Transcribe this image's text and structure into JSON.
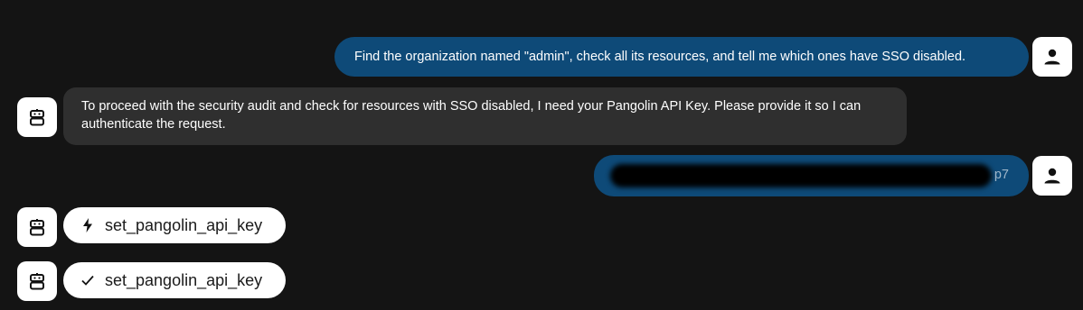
{
  "messages": [
    {
      "role": "user",
      "text": "Find the organization named \"admin\", check all its resources, and tell me which ones have SSO disabled."
    },
    {
      "role": "assistant",
      "text": "To proceed with the security audit and check for resources with SSO disabled, I need your Pangolin API Key. Please provide it so I can authenticate the request."
    },
    {
      "role": "user",
      "redacted": true,
      "visible_tail": "p7"
    },
    {
      "role": "tool",
      "status": "running",
      "status_icon": "lightning-icon",
      "name": "set_pangolin_api_key"
    },
    {
      "role": "tool",
      "status": "done",
      "status_icon": "checkmark-icon",
      "name": "set_pangolin_api_key"
    }
  ],
  "colors": {
    "background": "#141414",
    "user_bubble": "#0e4a78",
    "assistant_bubble": "#2f2f2f",
    "avatar_bg": "#ffffff"
  }
}
